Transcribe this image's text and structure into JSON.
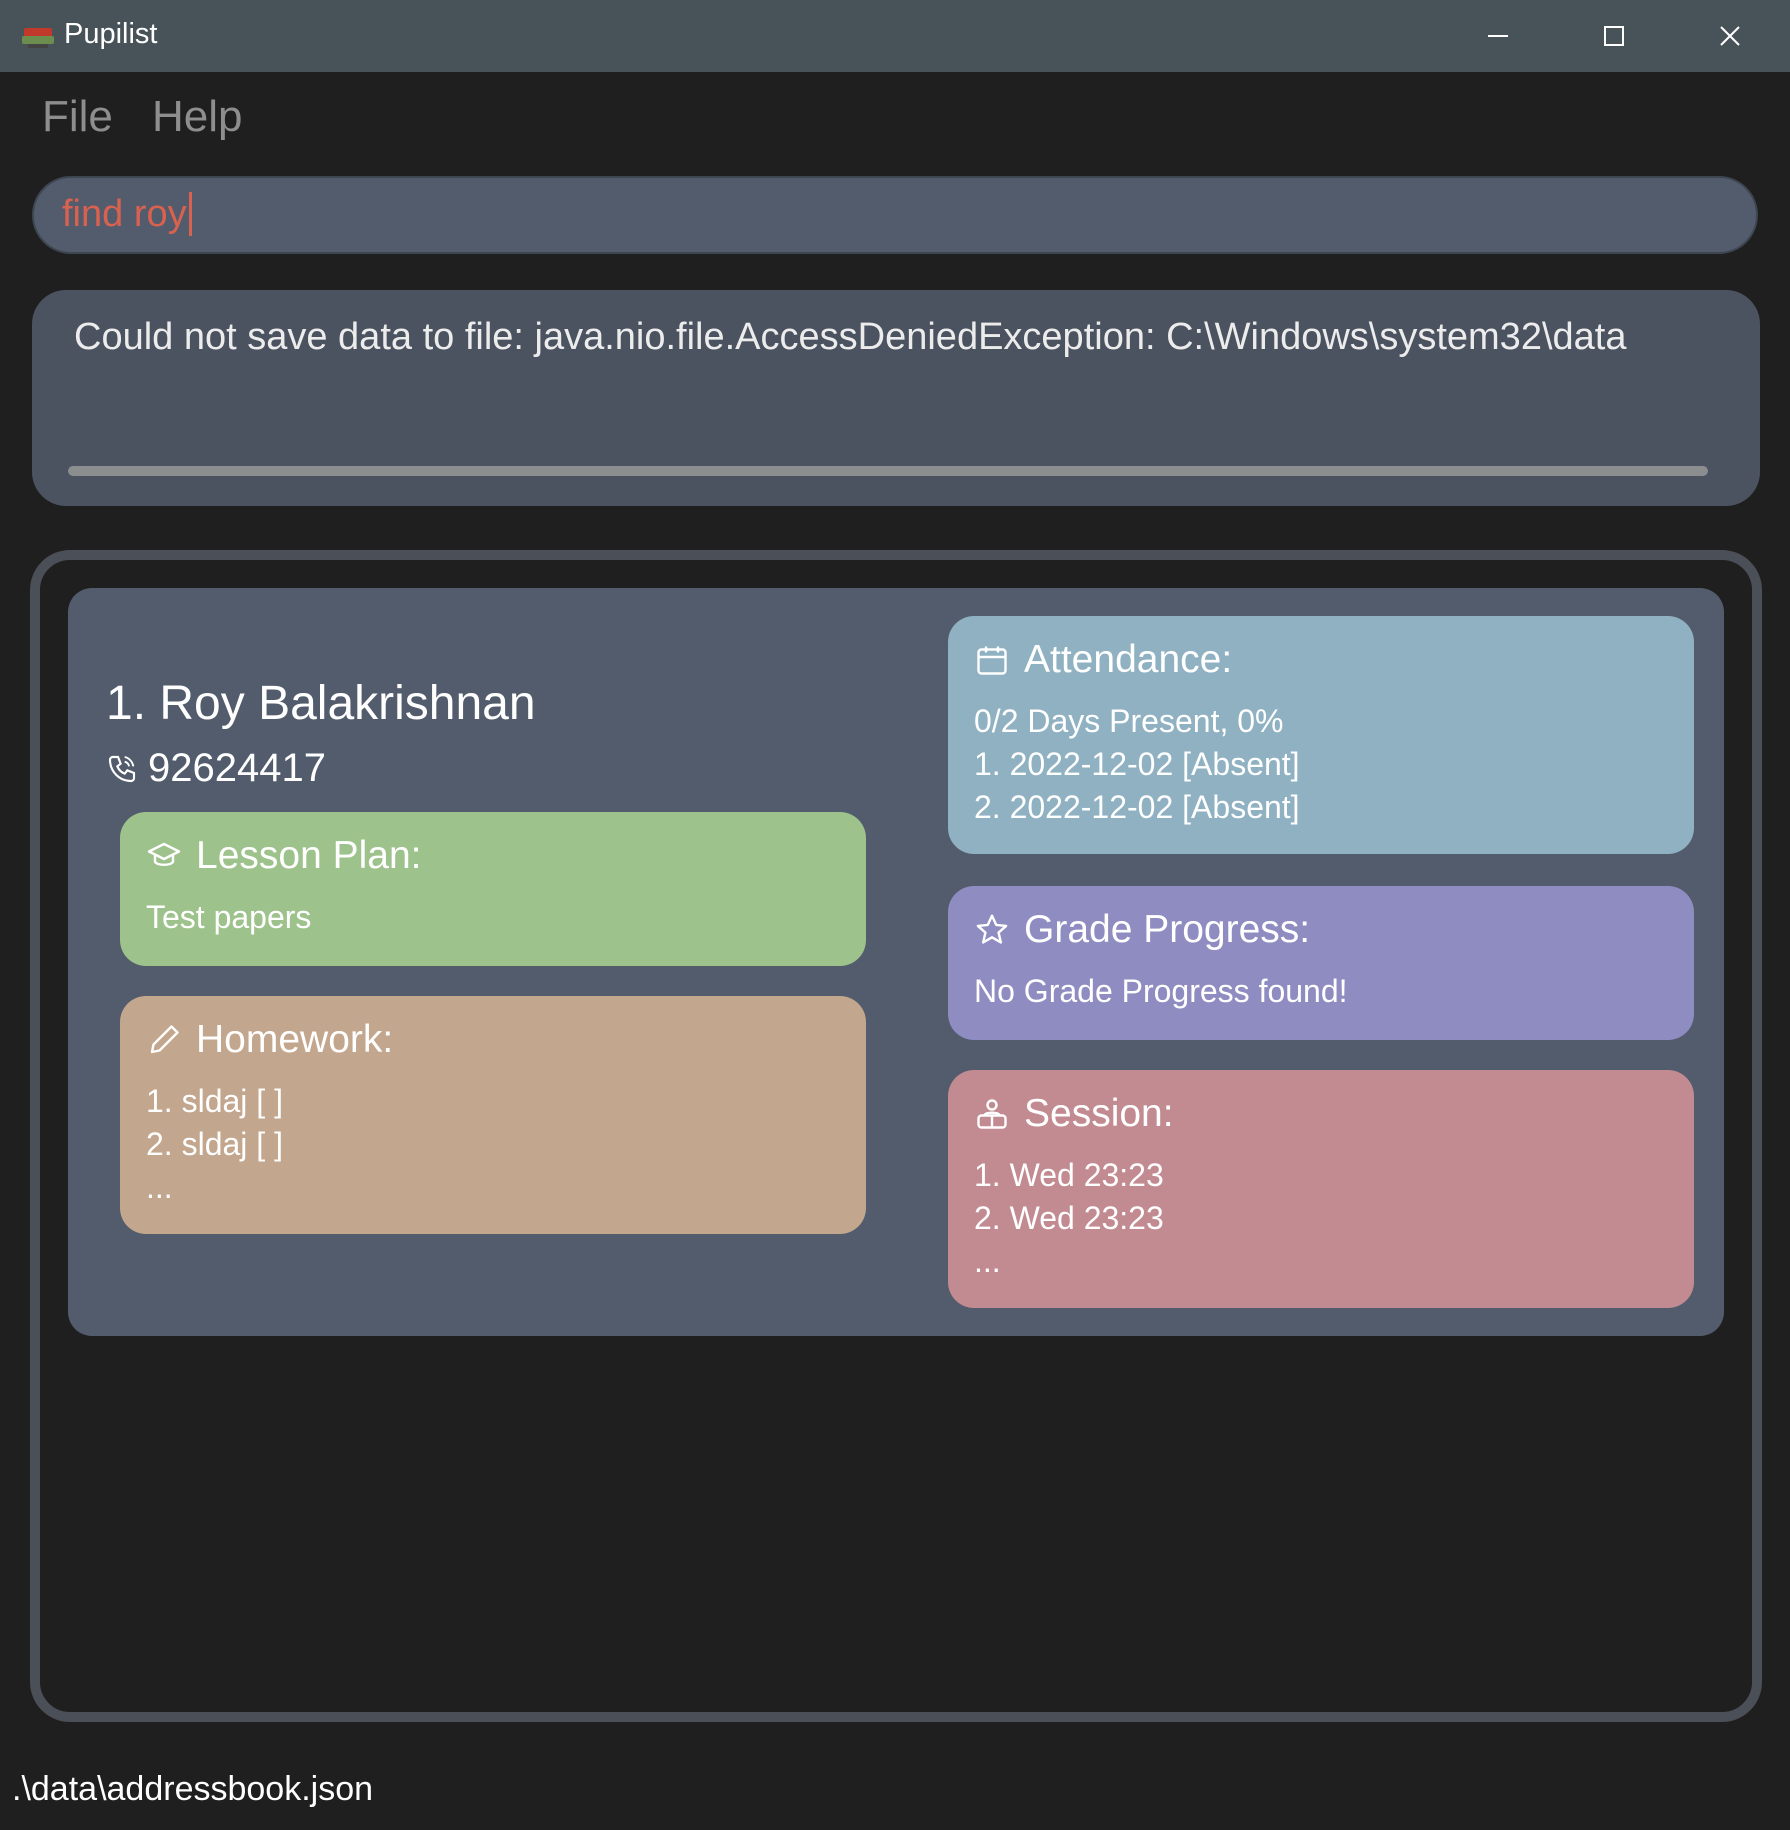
{
  "window": {
    "title": "Pupilist"
  },
  "menu": {
    "file": "File",
    "help": "Help"
  },
  "command": {
    "value": "find roy"
  },
  "result": {
    "message": "Could not save data to file: java.nio.file.AccessDeniedException: C:\\Windows\\system32\\data"
  },
  "person": {
    "index_name": "1.  Roy Balakrishnan",
    "phone": "92624417",
    "lesson_plan": {
      "title": "Lesson Plan:",
      "lines": [
        "Test papers"
      ]
    },
    "homework": {
      "title": "Homework:",
      "lines": [
        "1. sldaj [ ]",
        "2. sldaj [ ]",
        "..."
      ]
    },
    "attendance": {
      "title": "Attendance:",
      "lines": [
        "0/2 Days Present, 0%",
        "1. 2022-12-02 [Absent]",
        "2. 2022-12-02 [Absent]"
      ]
    },
    "grade_progress": {
      "title": "Grade Progress:",
      "lines": [
        "No Grade Progress found!"
      ]
    },
    "session": {
      "title": "Session:",
      "lines": [
        "1. Wed 23:23",
        "2. Wed 23:23",
        "..."
      ]
    }
  },
  "status": {
    "path": ".\\data\\addressbook.json"
  },
  "colors": {
    "lesson_plan": "#9ec28c",
    "homework": "#c3a68e",
    "attendance": "#8fb1c2",
    "grade_progress": "#8f8cc2",
    "session": "#c28b91",
    "command_text": "#d9614f"
  }
}
